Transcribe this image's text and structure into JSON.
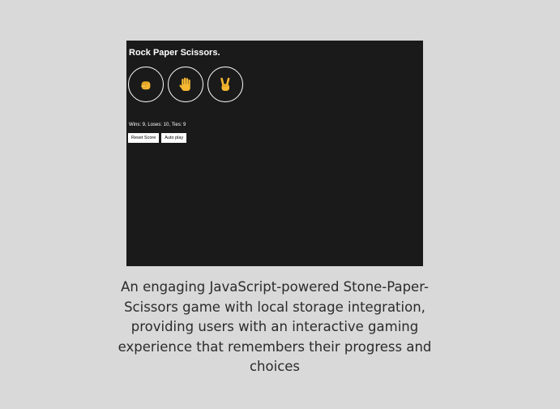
{
  "game": {
    "title": "Rock Paper Scissors.",
    "moves": [
      {
        "name": "Rock",
        "icon": "rock-fist-icon"
      },
      {
        "name": "Paper",
        "icon": "paper-hand-icon"
      },
      {
        "name": "Scissors",
        "icon": "scissors-hand-icon"
      }
    ],
    "score_text": "Wins: 9, Loses: 10, Ties: 9",
    "reset_label": "Reset Score",
    "autoplay_label": "Auto play"
  },
  "caption": "An engaging JavaScript-powered Stone-Paper-Scissors game with local storage integration, providing users with an interactive gaming experience that remembers their progress and choices",
  "colors": {
    "page_background": "#d9d9d9",
    "screen_background": "#1a1a1a",
    "emoji_yellow": "#f5b731",
    "text_white": "#ffffff",
    "caption_text": "#2b2b2b"
  }
}
